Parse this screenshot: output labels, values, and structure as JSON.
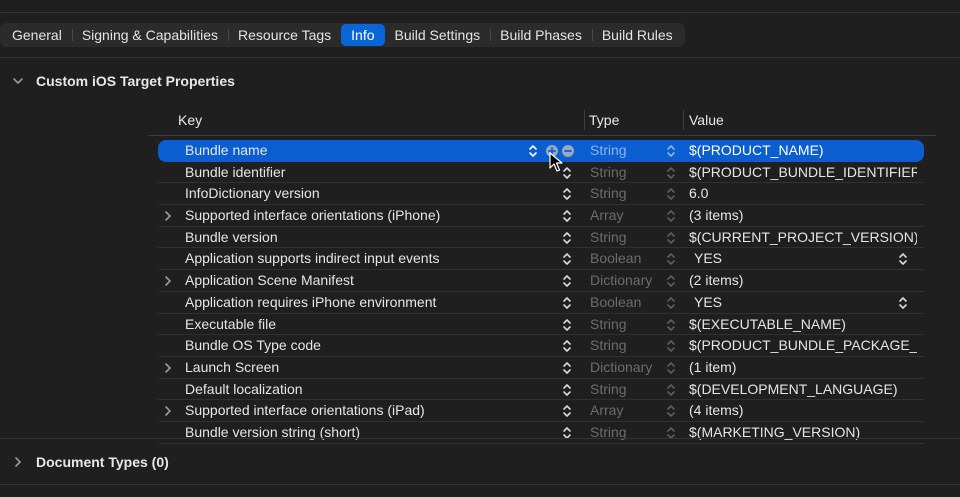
{
  "tabs": [
    "General",
    "Signing & Capabilities",
    "Resource Tags",
    "Info",
    "Build Settings",
    "Build Phases",
    "Build Rules"
  ],
  "active_tab": "Info",
  "section_custom": {
    "title": "Custom iOS Target Properties"
  },
  "columns": {
    "key": "Key",
    "type": "Type",
    "value": "Value"
  },
  "rows": [
    {
      "key": "Bundle name",
      "type": "String",
      "value": "$(PRODUCT_NAME)",
      "expandable": false,
      "selected": true
    },
    {
      "key": "Bundle identifier",
      "type": "String",
      "value": "$(PRODUCT_BUNDLE_IDENTIFIER)",
      "expandable": false
    },
    {
      "key": "InfoDictionary version",
      "type": "String",
      "value": "6.0",
      "expandable": false
    },
    {
      "key": "Supported interface orientations (iPhone)",
      "type": "Array",
      "value": "(3 items)",
      "expandable": true
    },
    {
      "key": "Bundle version",
      "type": "String",
      "value": "$(CURRENT_PROJECT_VERSION)",
      "expandable": false
    },
    {
      "key": "Application supports indirect input events",
      "type": "Boolean",
      "value": "YES",
      "expandable": false,
      "popup": true
    },
    {
      "key": "Application Scene Manifest",
      "type": "Dictionary",
      "value": "(2 items)",
      "expandable": true
    },
    {
      "key": "Application requires iPhone environment",
      "type": "Boolean",
      "value": "YES",
      "expandable": false,
      "popup": true
    },
    {
      "key": "Executable file",
      "type": "String",
      "value": "$(EXECUTABLE_NAME)",
      "expandable": false
    },
    {
      "key": "Bundle OS Type code",
      "type": "String",
      "value": "$(PRODUCT_BUNDLE_PACKAGE_TYPE)",
      "expandable": false
    },
    {
      "key": "Launch Screen",
      "type": "Dictionary",
      "value": "(1 item)",
      "expandable": true
    },
    {
      "key": "Default localization",
      "type": "String",
      "value": "$(DEVELOPMENT_LANGUAGE)",
      "expandable": false
    },
    {
      "key": "Supported interface orientations (iPad)",
      "type": "Array",
      "value": "(4 items)",
      "expandable": true
    },
    {
      "key": "Bundle version string (short)",
      "type": "String",
      "value": "$(MARKETING_VERSION)",
      "expandable": false
    }
  ],
  "section_document": {
    "title": "Document Types (0)"
  },
  "colors": {
    "accent": "#0a66d8",
    "selection": "#0a5ed0",
    "background": "#1f1f1f"
  }
}
